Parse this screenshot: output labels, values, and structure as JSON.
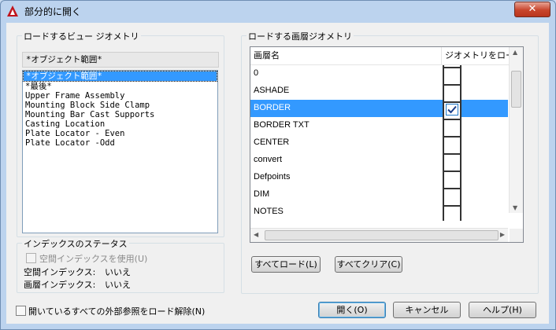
{
  "window": {
    "title": "部分的に開く",
    "close_label": "✕"
  },
  "views": {
    "group_label": "ロードするビュー ジオメトリ",
    "current": "*オブジェクト範囲*",
    "items": [
      "*オブジェクト範囲*",
      "*最後*",
      "Upper Frame Assembly",
      "Mounting Block Side Clamp",
      "Mounting Bar Cast Supports",
      "Casting Location",
      "Plate Locator - Even",
      "Plate Locator -Odd"
    ]
  },
  "index_status": {
    "group_label": "インデックスのステータス",
    "use_spatial_index": "空間インデックスを使用(U)",
    "spatial_label": "空間インデックス:",
    "spatial_value": "いいえ",
    "layer_label": "画層インデックス:",
    "layer_value": "いいえ"
  },
  "layers": {
    "group_label": "ロードする画層ジオメトリ",
    "col_name": "画層名",
    "col_load": "ジオメトリをロード",
    "rows": [
      {
        "name": "0",
        "checked": false
      },
      {
        "name": "ASHADE",
        "checked": false
      },
      {
        "name": "BORDER",
        "checked": true,
        "selected": true
      },
      {
        "name": "BORDER TXT",
        "checked": false
      },
      {
        "name": "CENTER",
        "checked": false
      },
      {
        "name": "convert",
        "checked": false
      },
      {
        "name": "Defpoints",
        "checked": false
      },
      {
        "name": "DIM",
        "checked": false
      },
      {
        "name": "NOTES",
        "checked": false
      }
    ],
    "load_all": "すべてロード(L)",
    "clear_all": "すべてクリア(C)"
  },
  "footer": {
    "unload_xrefs": "開いているすべての外部参照をロード解除(N)",
    "open": "開く(O)",
    "cancel": "キャンセル",
    "help": "ヘルプ(H)"
  }
}
